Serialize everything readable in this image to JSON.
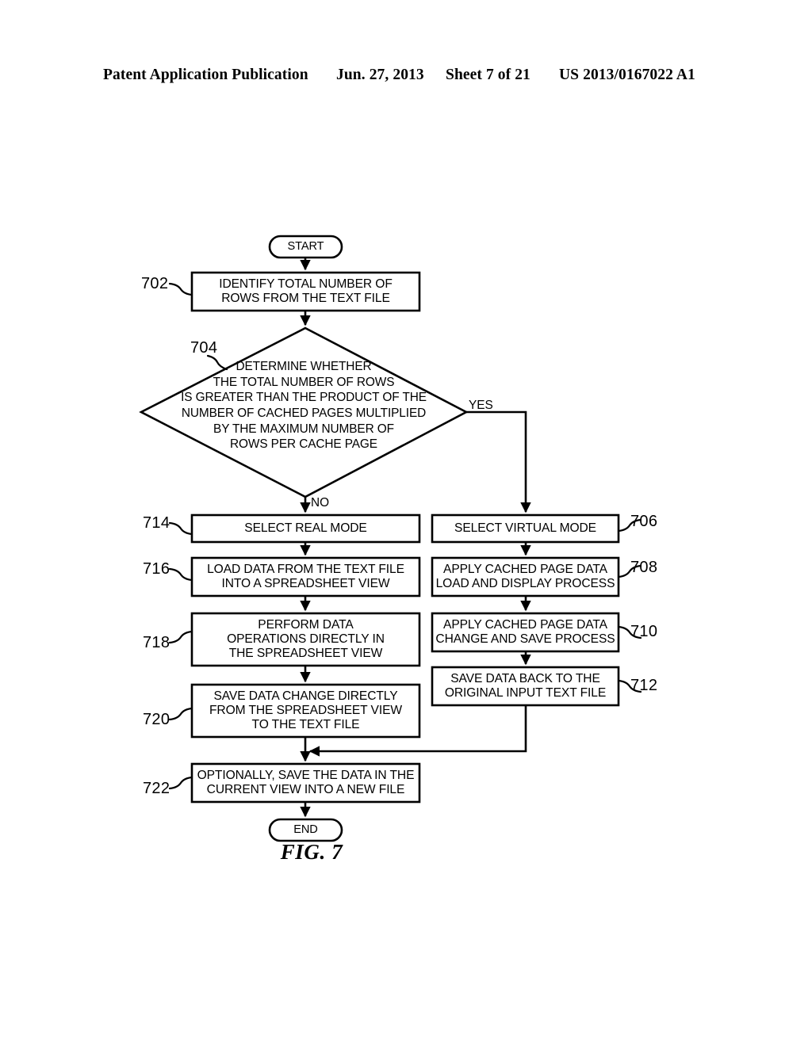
{
  "header": {
    "publication": "Patent Application Publication",
    "date": "Jun. 27, 2013",
    "sheet": "Sheet 7 of 21",
    "patent_number": "US 2013/0167022 A1"
  },
  "figure": {
    "caption": "FIG. 7",
    "terminators": {
      "start": "START",
      "end": "END"
    },
    "branch_labels": {
      "yes": "YES",
      "no": "NO"
    },
    "nodes": [
      {
        "id": "702",
        "ref": "702",
        "shape": "process",
        "text": "IDENTIFY TOTAL NUMBER OF\nROWS FROM THE TEXT FILE"
      },
      {
        "id": "704",
        "ref": "704",
        "shape": "decision",
        "text": "DETERMINE WHETHER\nTHE TOTAL NUMBER OF ROWS\nIS GREATER THAN THE PRODUCT OF THE\nNUMBER OF CACHED PAGES MULTIPLIED\nBY THE MAXIMUM NUMBER OF\nROWS PER CACHE PAGE"
      },
      {
        "id": "706",
        "ref": "706",
        "shape": "process",
        "text": "SELECT VIRTUAL MODE"
      },
      {
        "id": "708",
        "ref": "708",
        "shape": "process",
        "text": "APPLY CACHED PAGE DATA\nLOAD AND DISPLAY PROCESS"
      },
      {
        "id": "710",
        "ref": "710",
        "shape": "process",
        "text": "APPLY CACHED PAGE DATA\nCHANGE AND SAVE PROCESS"
      },
      {
        "id": "712",
        "ref": "712",
        "shape": "process",
        "text": "SAVE DATA BACK TO THE\nORIGINAL INPUT TEXT FILE"
      },
      {
        "id": "714",
        "ref": "714",
        "shape": "process",
        "text": "SELECT REAL MODE"
      },
      {
        "id": "716",
        "ref": "716",
        "shape": "process",
        "text": "LOAD DATA FROM THE TEXT FILE\nINTO A SPREADSHEET VIEW"
      },
      {
        "id": "718",
        "ref": "718",
        "shape": "process",
        "text": "PERFORM DATA\nOPERATIONS DIRECTLY IN\nTHE SPREADSHEET VIEW"
      },
      {
        "id": "720",
        "ref": "720",
        "shape": "process",
        "text": "SAVE DATA CHANGE DIRECTLY\nFROM THE SPREADSHEET VIEW\nTO THE TEXT FILE"
      },
      {
        "id": "722",
        "ref": "722",
        "shape": "process",
        "text": "OPTIONALLY, SAVE THE DATA IN THE\nCURRENT VIEW INTO A NEW FILE"
      }
    ],
    "colors": {
      "line": "#000000",
      "background": "#ffffff",
      "text": "#000000"
    }
  }
}
